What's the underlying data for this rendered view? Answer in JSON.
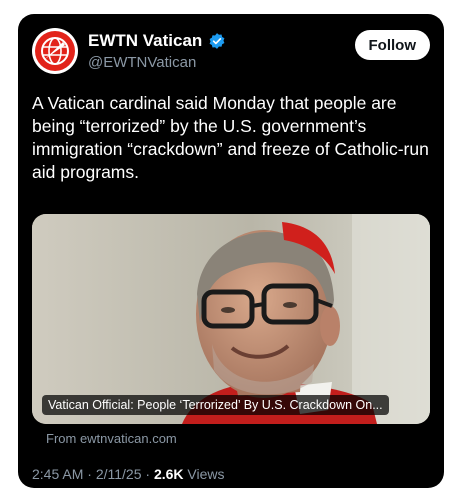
{
  "account": {
    "name": "EWTN Vatican",
    "handle": "@EWTNVatican",
    "verified_icon": "verified-badge-icon",
    "avatar_icon": "ewtn-globe-logo-icon",
    "brand_color": "#e2231a",
    "verified_color": "#1d9bf0"
  },
  "actions": {
    "follow_label": "Follow"
  },
  "tweet": {
    "text": "A Vatican cardinal said Monday that people are being “terrorized” by the U.S. government’s immigration “crackdown” and freeze of Catholic-run aid programs."
  },
  "link_card": {
    "caption": "Vatican Official: People ‘Terrorized’ By U.S. Crackdown On...",
    "source": "From ewtnvatican.com",
    "image_subject": "cardinal-portrait-photo"
  },
  "meta": {
    "time": "2:45 AM",
    "separator1": " · ",
    "date": "2/11/25",
    "separator2": " · ",
    "views_count": "2.6K",
    "views_label": " Views"
  }
}
